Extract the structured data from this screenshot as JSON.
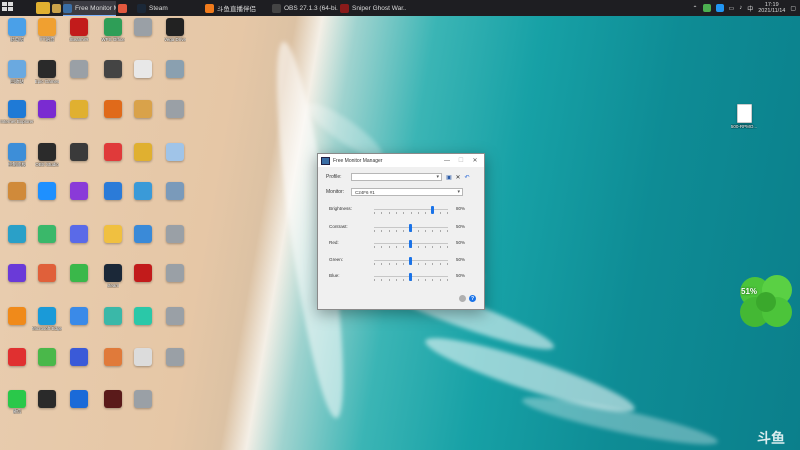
{
  "taskbar": {
    "tasks": [
      {
        "label": "",
        "color": "#caa24a"
      },
      {
        "label": "Free Monitor Ma...",
        "color": "#3a6ea5",
        "active": true
      },
      {
        "label": "",
        "color": "#e2583e"
      },
      {
        "label": "Steam",
        "color": "#1b2838"
      },
      {
        "label": "斗鱼直播伴侣",
        "color": "#f07b1c"
      },
      {
        "label": "OBS 27.1.3 (64-bi...",
        "color": "#444444"
      },
      {
        "label": "Sniper Ghost War...",
        "color": "#8a1a1a"
      }
    ],
    "clock_time": "17:19",
    "clock_date": "2021/11/14"
  },
  "desktop": {
    "icons": [
      {
        "label": "此电脑",
        "color": "#4aa0e8"
      },
      {
        "label": "YY语音",
        "color": "#f0a030"
      },
      {
        "label": "SteamVR",
        "color": "#c21b1b"
      },
      {
        "label": "WPS Office",
        "color": "#2e9e57"
      },
      {
        "label": "",
        "color": "#9aa0a6"
      },
      {
        "label": "Vega Drive",
        "color": "#222222"
      },
      {
        "label": "回收站",
        "color": "#6aa9e0"
      },
      {
        "label": "Epic Games",
        "color": "#2a2a2a"
      },
      {
        "label": "",
        "color": "#9aa0a6"
      },
      {
        "label": "",
        "color": "#444444"
      },
      {
        "label": "",
        "color": "#e8e8e8"
      },
      {
        "label": "",
        "color": "#8aa0b0"
      },
      {
        "label": "Internet Explorer",
        "color": "#1f7ad6"
      },
      {
        "label": "",
        "color": "#7a2bd1"
      },
      {
        "label": "",
        "color": "#e0b030"
      },
      {
        "label": "",
        "color": "#e06a1a"
      },
      {
        "label": "",
        "color": "#d9a24a"
      },
      {
        "label": "",
        "color": "#9aa0a6"
      },
      {
        "label": "控制面板",
        "color": "#3d8ed8"
      },
      {
        "label": "OBS Studio",
        "color": "#2b2b2b"
      },
      {
        "label": "",
        "color": "#3a3a3a"
      },
      {
        "label": "",
        "color": "#e03a3a"
      },
      {
        "label": "",
        "color": "#e0b030"
      },
      {
        "label": "",
        "color": "#a0c4e8"
      },
      {
        "label": "",
        "color": "#d08a3a"
      },
      {
        "label": "",
        "color": "#1e90ff"
      },
      {
        "label": "",
        "color": "#8a3ad8"
      },
      {
        "label": "",
        "color": "#2b7bd8"
      },
      {
        "label": "",
        "color": "#3a9ad8"
      },
      {
        "label": "",
        "color": "#7a9aba"
      },
      {
        "label": "",
        "color": "#2aa0c8"
      },
      {
        "label": "",
        "color": "#3ab86a"
      },
      {
        "label": "",
        "color": "#5a6ae8"
      },
      {
        "label": "",
        "color": "#f0c040"
      },
      {
        "label": "",
        "color": "#3a8ad8"
      },
      {
        "label": "",
        "color": "#9aa0a6"
      },
      {
        "label": "",
        "color": "#6a3ad8"
      },
      {
        "label": "",
        "color": "#e0603a"
      },
      {
        "label": "",
        "color": "#3ab84a"
      },
      {
        "label": "steam",
        "color": "#1b2838"
      },
      {
        "label": "",
        "color": "#c21b1b"
      },
      {
        "label": "",
        "color": "#9aa0a6"
      },
      {
        "label": "",
        "color": "#f08a1a"
      },
      {
        "label": "Microsoft Edge",
        "color": "#1a9ad8"
      },
      {
        "label": "",
        "color": "#3a8ae8"
      },
      {
        "label": "",
        "color": "#3ab8a8"
      },
      {
        "label": "",
        "color": "#2ac8a8"
      },
      {
        "label": "",
        "color": "#9aa0a6"
      },
      {
        "label": "",
        "color": "#e03030"
      },
      {
        "label": "",
        "color": "#4ab84a"
      },
      {
        "label": "",
        "color": "#3a5ad8"
      },
      {
        "label": "",
        "color": "#e07a3a"
      },
      {
        "label": "",
        "color": "#dcdcdc"
      },
      {
        "label": "",
        "color": "#9aa0a6"
      },
      {
        "label": "微信",
        "color": "#2ac84a"
      },
      {
        "label": "",
        "color": "#2a2a2a"
      },
      {
        "label": "",
        "color": "#1a6ad8"
      },
      {
        "label": "",
        "color": "#5a1a1a"
      },
      {
        "label": "",
        "color": "#9aa0a6"
      }
    ],
    "file_icon_label": "500-RPMO...",
    "gadget_percent": "51%"
  },
  "window": {
    "title": "Free Monitor Manager",
    "profile_label": "Profile:",
    "profile_value": "",
    "monitor_label": "Monitor:",
    "monitor_value": "C24F6 #1",
    "sliders": [
      {
        "label": "Brightness:",
        "value": 80,
        "value_text": "80%"
      },
      {
        "label": "Contrast:",
        "value": 50,
        "value_text": "50%"
      },
      {
        "label": "Red:",
        "value": 50,
        "value_text": "50%"
      },
      {
        "label": "Green:",
        "value": 50,
        "value_text": "50%"
      },
      {
        "label": "Blue:",
        "value": 50,
        "value_text": "50%"
      }
    ]
  },
  "watermark": "斗鱼"
}
